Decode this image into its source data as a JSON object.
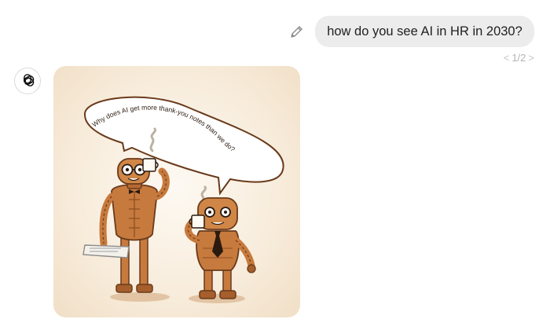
{
  "user_message": {
    "text": "how do you see AI in HR in 2030?"
  },
  "pager": {
    "prev": "<",
    "current": "1/2",
    "next": ">"
  },
  "image": {
    "speech_bubble": {
      "text": "Why does AI get more thank-you notes than we do?"
    }
  },
  "icons": {
    "edit": "pencil-icon",
    "avatar": "openai-logo-icon"
  },
  "colors": {
    "user_bubble_bg": "#ececec",
    "robot_orange": "#c77a3d",
    "image_bg": "#f8eddd"
  }
}
